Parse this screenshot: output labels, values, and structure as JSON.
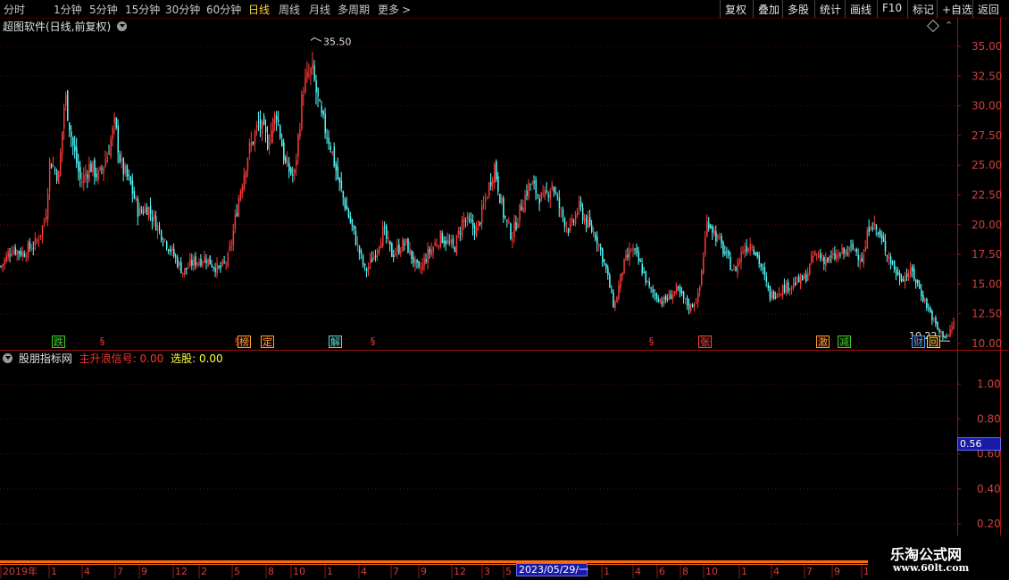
{
  "toolbar": {
    "periods": [
      "分时",
      "1分钟",
      "5分钟",
      "15分钟",
      "30分钟",
      "60分钟",
      "日线",
      "周线",
      "月线",
      "多周期",
      "更多"
    ],
    "active_period": "日线",
    "more_arrow": ">",
    "right_buttons": [
      "复权",
      "叠加",
      "多股",
      "统计",
      "画线",
      "F10",
      "标记",
      "+自选",
      "返回"
    ]
  },
  "main_chart": {
    "title": "超图软件(日线,前复权)",
    "max_label": "35.50",
    "min_label": "10.22",
    "signals": [
      {
        "label": "跌",
        "color": "#2fd12f",
        "style": "box"
      },
      {
        "label": "§",
        "color": "#ff3333",
        "style": "plain"
      },
      {
        "label": "§",
        "color": "#ff3333",
        "style": "plain"
      },
      {
        "label": "榜",
        "color": "#ffa030",
        "style": "box"
      },
      {
        "label": "定",
        "color": "#ffa030",
        "style": "box"
      },
      {
        "label": "解",
        "color": "#40e0e0",
        "style": "box"
      },
      {
        "label": "§",
        "color": "#ff3333",
        "style": "plain"
      },
      {
        "label": "§",
        "color": "#ff3333",
        "style": "plain"
      },
      {
        "label": "张",
        "color": "#ff4040",
        "style": "box"
      },
      {
        "label": "激",
        "color": "#ffa030",
        "style": "box"
      },
      {
        "label": "减",
        "color": "#2fd12f",
        "style": "box"
      },
      {
        "label": "财",
        "color": "#40a0ff",
        "style": "box"
      },
      {
        "label": "回",
        "color": "#ffd83a",
        "style": "box"
      }
    ]
  },
  "indicator": {
    "name": "股朋指标网",
    "series": [
      {
        "name": "主升浪信号",
        "value": "0.00",
        "color": "#ff3030"
      },
      {
        "name": "选股",
        "value": "0.00",
        "color": "#ffff40"
      }
    ],
    "cursor_value": "0.56",
    "y_ticks": [
      "1.00",
      "0.80",
      "0.60",
      "0.40",
      "0.20"
    ]
  },
  "time_axis": {
    "labels": [
      "2019年",
      "1",
      "4",
      "7",
      "9",
      "12",
      "2",
      "5",
      "8",
      "10",
      "1",
      "4",
      "7",
      "9",
      "12",
      "3",
      "5",
      "1",
      "4",
      "6",
      "8",
      "10",
      "1",
      "4",
      "7",
      "9",
      "12"
    ],
    "cursor_date": "2023/05/29/一"
  },
  "watermark": {
    "title": "乐淘公式网",
    "url": "www.60lt.com"
  },
  "chart_data": {
    "type": "candlestick",
    "title": "超图软件(日线,前复权)",
    "y_ticks": [
      35.0,
      32.5,
      30.0,
      27.5,
      25.0,
      22.5,
      20.0,
      17.5,
      15.0,
      12.5,
      10.0
    ],
    "ylim": [
      9.4,
      36.8
    ],
    "max": 35.5,
    "min": 10.22,
    "close_path": [
      [
        0,
        16.5
      ],
      [
        0.012,
        18.0
      ],
      [
        0.025,
        17.6
      ],
      [
        0.04,
        18.5
      ],
      [
        0.05,
        20.5
      ],
      [
        0.055,
        25.5
      ],
      [
        0.065,
        24.0
      ],
      [
        0.072,
        31.0
      ],
      [
        0.08,
        27.0
      ],
      [
        0.09,
        23.5
      ],
      [
        0.1,
        25.0
      ],
      [
        0.11,
        24.0
      ],
      [
        0.12,
        26.0
      ],
      [
        0.128,
        28.5
      ],
      [
        0.135,
        25.0
      ],
      [
        0.145,
        23.5
      ],
      [
        0.155,
        21.0
      ],
      [
        0.165,
        21.5
      ],
      [
        0.175,
        20.0
      ],
      [
        0.19,
        18.0
      ],
      [
        0.205,
        16.0
      ],
      [
        0.215,
        16.8
      ],
      [
        0.23,
        17.2
      ],
      [
        0.245,
        16.2
      ],
      [
        0.255,
        17.0
      ],
      [
        0.26,
        18.8
      ],
      [
        0.268,
        22.5
      ],
      [
        0.278,
        26.0
      ],
      [
        0.29,
        28.5
      ],
      [
        0.3,
        27.0
      ],
      [
        0.31,
        29.5
      ],
      [
        0.32,
        25.0
      ],
      [
        0.33,
        24.0
      ],
      [
        0.34,
        31.5
      ],
      [
        0.35,
        33.0
      ],
      [
        0.36,
        29.0
      ],
      [
        0.37,
        27.0
      ],
      [
        0.38,
        23.5
      ],
      [
        0.39,
        21.0
      ],
      [
        0.4,
        18.5
      ],
      [
        0.41,
        16.0
      ],
      [
        0.42,
        17.5
      ],
      [
        0.43,
        19.5
      ],
      [
        0.44,
        17.5
      ],
      [
        0.455,
        18.5
      ],
      [
        0.47,
        16.0
      ],
      [
        0.48,
        17.5
      ],
      [
        0.495,
        19.0
      ],
      [
        0.51,
        18.0
      ],
      [
        0.52,
        20.5
      ],
      [
        0.535,
        19.5
      ],
      [
        0.545,
        22.0
      ],
      [
        0.555,
        25.0
      ],
      [
        0.565,
        21.0
      ],
      [
        0.575,
        19.0
      ],
      [
        0.585,
        21.5
      ],
      [
        0.595,
        23.5
      ],
      [
        0.61,
        22.0
      ],
      [
        0.62,
        23.5
      ],
      [
        0.63,
        21.0
      ],
      [
        0.64,
        19.5
      ],
      [
        0.65,
        21.5
      ],
      [
        0.66,
        20.0
      ],
      [
        0.67,
        19.0
      ],
      [
        0.68,
        16.5
      ],
      [
        0.69,
        13.0
      ],
      [
        0.7,
        16.5
      ],
      [
        0.71,
        18.0
      ],
      [
        0.72,
        16.5
      ],
      [
        0.73,
        14.5
      ],
      [
        0.745,
        13.5
      ],
      [
        0.76,
        14.5
      ],
      [
        0.775,
        13.0
      ],
      [
        0.785,
        14.0
      ],
      [
        0.795,
        20.5
      ],
      [
        0.805,
        19.0
      ],
      [
        0.815,
        17.5
      ],
      [
        0.825,
        16.0
      ],
      [
        0.835,
        18.0
      ],
      [
        0.845,
        18.5
      ],
      [
        0.855,
        16.5
      ],
      [
        0.865,
        14.0
      ],
      [
        0.875,
        14.5
      ],
      [
        0.89,
        15.0
      ],
      [
        0.905,
        15.5
      ],
      [
        0.915,
        17.5
      ],
      [
        0.93,
        17.0
      ],
      [
        0.945,
        17.5
      ],
      [
        0.96,
        18.0
      ],
      [
        0.97,
        17.0
      ],
      [
        0.978,
        20.5
      ],
      [
        0.985,
        19.5
      ],
      [
        0.995,
        18.0
      ],
      [
        1.01,
        15.5
      ],
      [
        1.025,
        16.0
      ],
      [
        1.04,
        13.5
      ],
      [
        1.055,
        11.0
      ],
      [
        1.065,
        10.5
      ],
      [
        1.072,
        11.8
      ]
    ]
  }
}
